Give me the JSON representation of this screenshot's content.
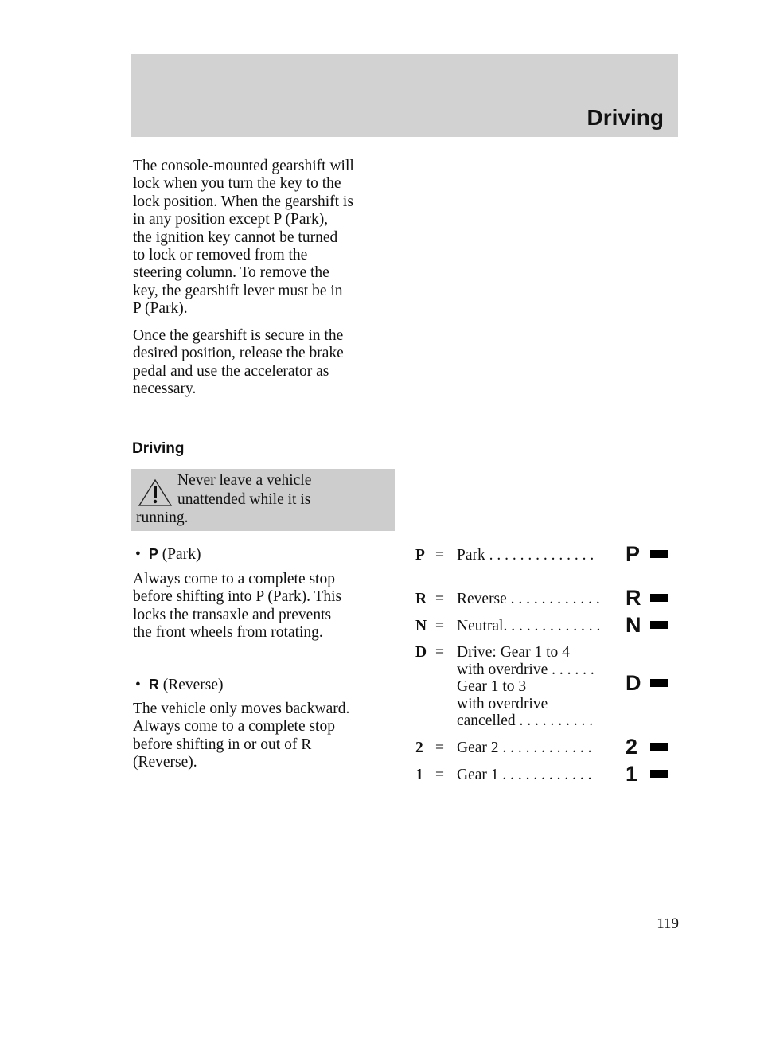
{
  "header": {
    "title": "Driving"
  },
  "intro": {
    "p1": [
      "The console-mounted gearshift will",
      "lock when you turn the key to the",
      "lock position. When the gearshift is",
      "in any position except P (Park),",
      "the ignition key cannot be turned",
      "to lock or removed from the",
      "steering column. To remove the",
      "key, the gearshift lever must be in",
      "P (Park)."
    ],
    "p2": [
      "Once the gearshift is secure in the",
      "desired position, release the brake",
      "pedal and use the accelerator as",
      "necessary."
    ]
  },
  "section": {
    "title": "Driving"
  },
  "warning": {
    "icon": "warning-triangle-icon",
    "lines": [
      "Never leave a vehicle",
      "unattended while it is",
      "running."
    ]
  },
  "park": {
    "letter": "P",
    "label": "(Park)",
    "lines": [
      "Always come to a complete stop",
      "before shifting into P (Park). This",
      "locks the transaxle and prevents",
      "the front wheels from rotating."
    ]
  },
  "reverse": {
    "letter": "R",
    "label": "(Reverse)",
    "lines": [
      "The vehicle only moves backward.",
      "Always come to a complete stop",
      "before shifting in or out of R",
      "(Reverse)."
    ]
  },
  "gears": [
    {
      "key": "P",
      "eq": "=",
      "desc": [
        "Park . . . . . . . . . . . . . ."
      ],
      "symbol": "P"
    },
    {
      "key": "R",
      "eq": "=",
      "desc": [
        "Reverse . . . . . . . . . . . ."
      ],
      "symbol": "R"
    },
    {
      "key": "N",
      "eq": "=",
      "desc": [
        "Neutral. . . . . . . . . . . . ."
      ],
      "symbol": "N"
    },
    {
      "key": "D",
      "eq": "=",
      "desc": [
        "Drive: Gear 1 to 4",
        "with overdrive . . . . . .",
        "Gear 1 to 3",
        "with overdrive",
        "cancelled . . . . . . . . . ."
      ],
      "symbol": "D"
    },
    {
      "key": "2",
      "eq": "=",
      "desc": [
        "Gear 2 . . . . . . . . . . . ."
      ],
      "symbol": "2"
    },
    {
      "key": "1",
      "eq": "=",
      "desc": [
        "Gear 1 . . . . . . . . . . . ."
      ],
      "symbol": "1"
    }
  ],
  "page_number": "119"
}
